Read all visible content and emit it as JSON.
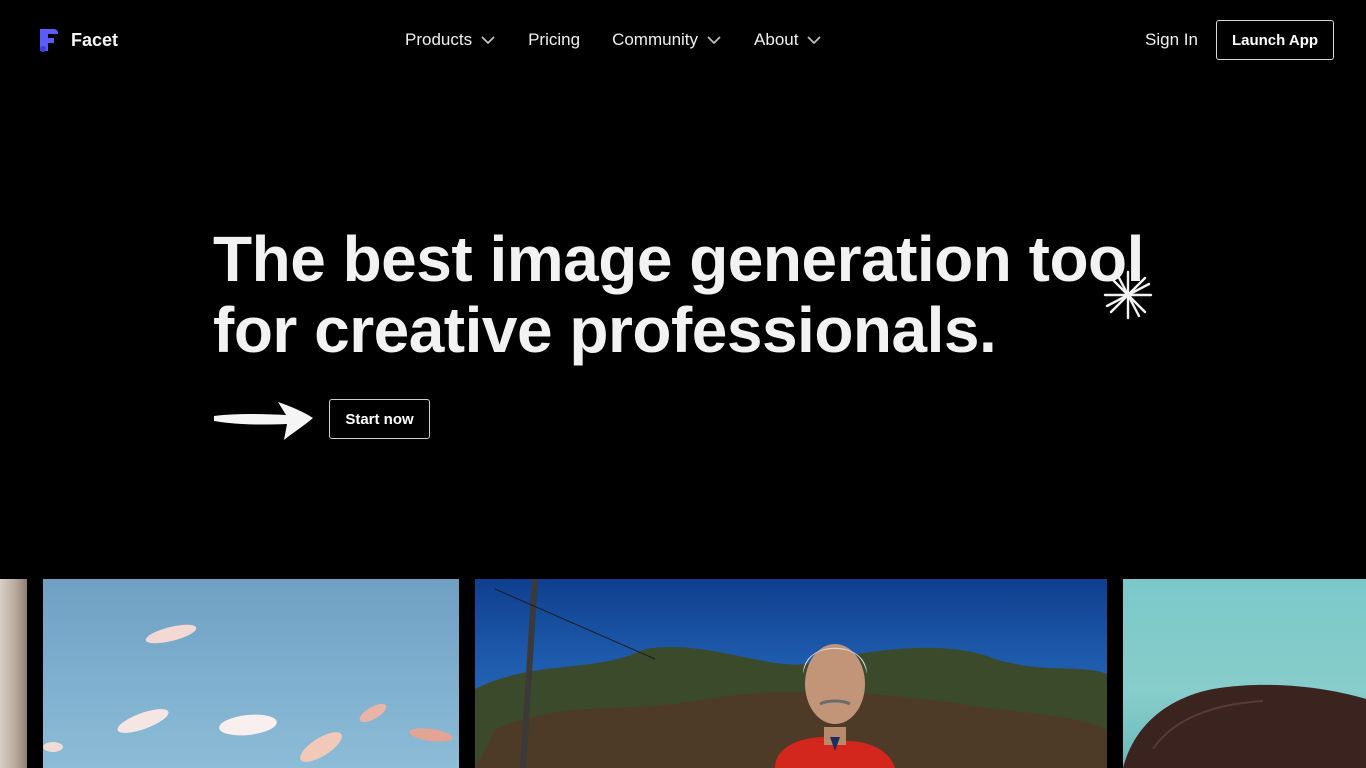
{
  "brand": {
    "name": "Facet",
    "icon": "facet-logo-icon",
    "accent": "#5b5cf6"
  },
  "nav": {
    "items": [
      {
        "label": "Products",
        "has_dropdown": true
      },
      {
        "label": "Pricing",
        "has_dropdown": false
      },
      {
        "label": "Community",
        "has_dropdown": true
      },
      {
        "label": "About",
        "has_dropdown": true
      }
    ],
    "sign_in": "Sign In",
    "launch_app": "Launch App"
  },
  "hero": {
    "title_line1": "The best image generation tool",
    "title_line2": "for creative professionals.",
    "cta": "Start now",
    "decor_icons": [
      "sparkle-icon",
      "hand-drawn-arrow-icon"
    ]
  },
  "gallery": {
    "images": [
      {
        "name": "gallery-image-portrait-partial"
      },
      {
        "name": "gallery-image-koi-fish-sky"
      },
      {
        "name": "gallery-image-man-red-jacket"
      },
      {
        "name": "gallery-image-dark-hair-teal"
      }
    ]
  },
  "colors": {
    "background": "#000000",
    "text": "#f2f2f2",
    "button_border": "#d9d9d9"
  }
}
